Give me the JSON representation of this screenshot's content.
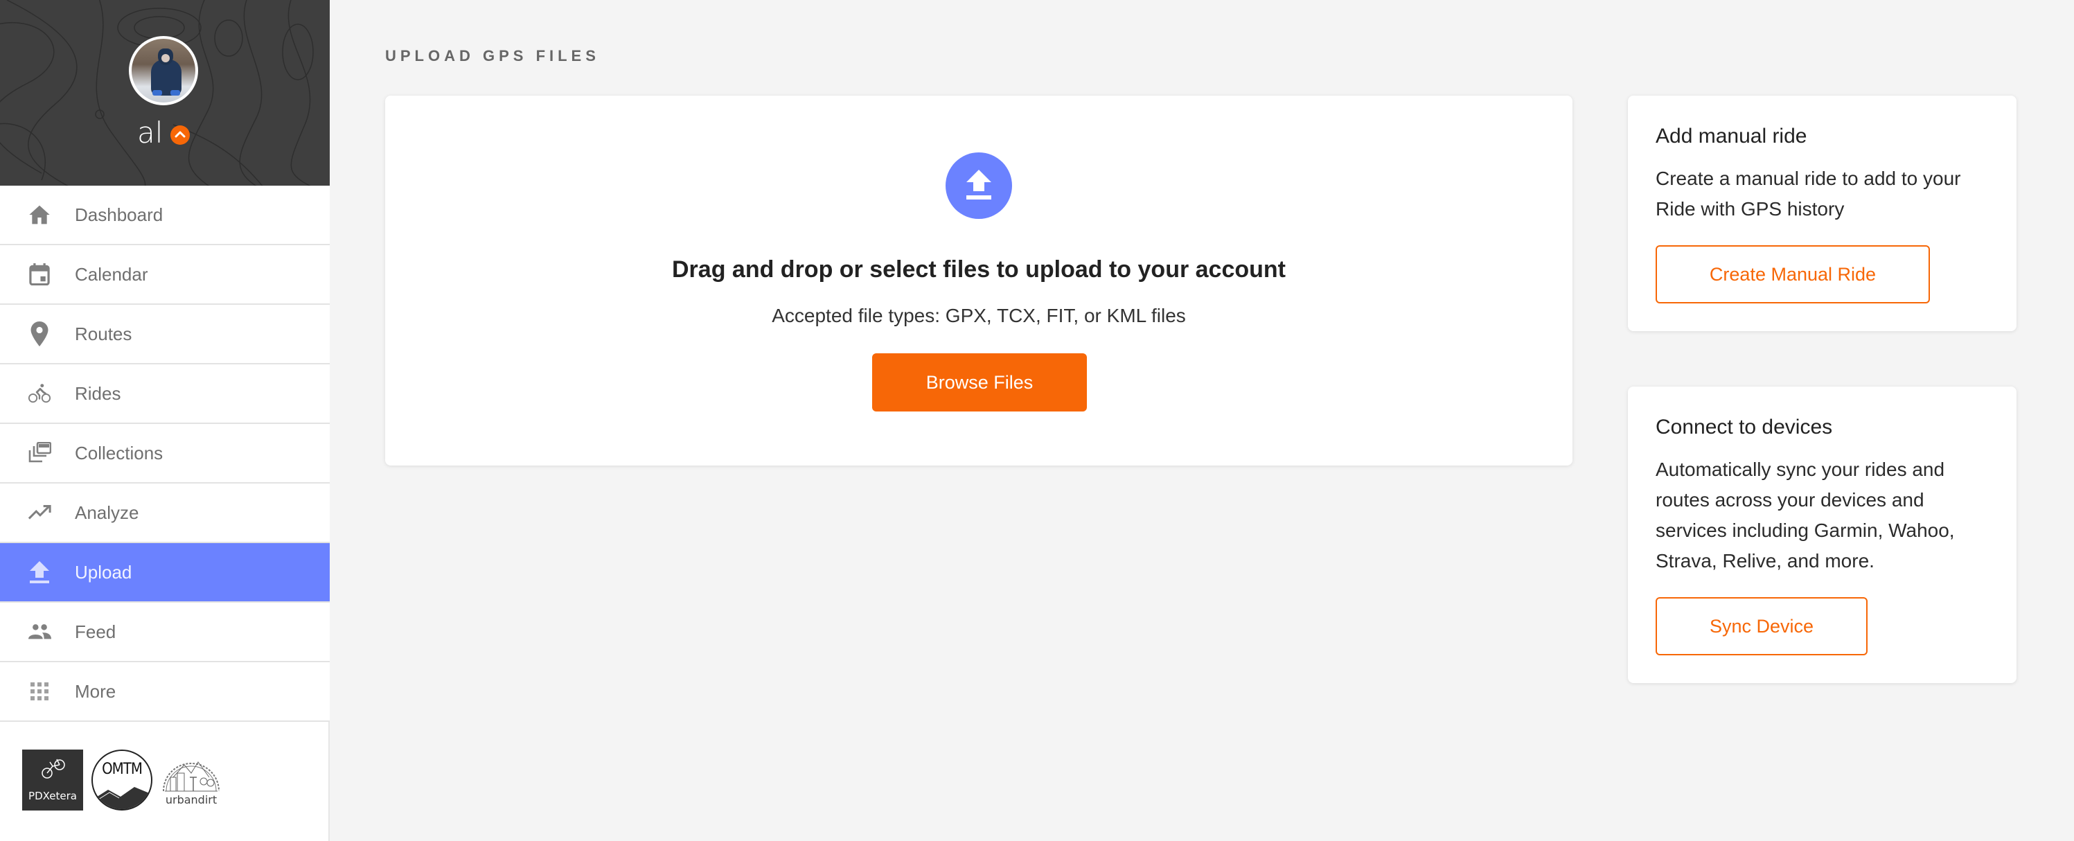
{
  "user": {
    "name": "al",
    "menu_toggle_icon": "chevron-up-icon"
  },
  "sidebar": {
    "items": [
      {
        "label": "Dashboard",
        "icon": "home-icon",
        "active": false
      },
      {
        "label": "Calendar",
        "icon": "calendar-icon",
        "active": false
      },
      {
        "label": "Routes",
        "icon": "map-pin-icon",
        "active": false
      },
      {
        "label": "Rides",
        "icon": "cyclist-icon",
        "active": false
      },
      {
        "label": "Collections",
        "icon": "collections-icon",
        "active": false
      },
      {
        "label": "Analyze",
        "icon": "trending-up-icon",
        "active": false
      },
      {
        "label": "Upload",
        "icon": "upload-icon",
        "active": true
      },
      {
        "label": "Feed",
        "icon": "people-icon",
        "active": false
      },
      {
        "label": "More",
        "icon": "grid-icon",
        "active": false
      }
    ],
    "partners": [
      {
        "name": "PDXetera"
      },
      {
        "name": "OMTM"
      },
      {
        "name": "urbandirt"
      }
    ]
  },
  "main": {
    "title": "UPLOAD GPS FILES",
    "upload": {
      "heading": "Drag and drop or select files to upload to your account",
      "subtext": "Accepted file types: GPX, TCX, FIT, or KML files",
      "button_label": "Browse Files"
    },
    "manual_ride": {
      "title": "Add manual ride",
      "description": "Create a manual ride to add to your Ride with GPS history",
      "button_label": "Create Manual Ride"
    },
    "devices": {
      "title": "Connect to devices",
      "description": "Automatically sync your rides and routes across your devices and services including Garmin, Wahoo, Strava, Relive, and more.",
      "button_label": "Sync Device"
    }
  },
  "colors": {
    "accent_orange": "#f76707",
    "active_blue": "#6b82ff",
    "sidebar_dark": "#3f3f3f"
  }
}
